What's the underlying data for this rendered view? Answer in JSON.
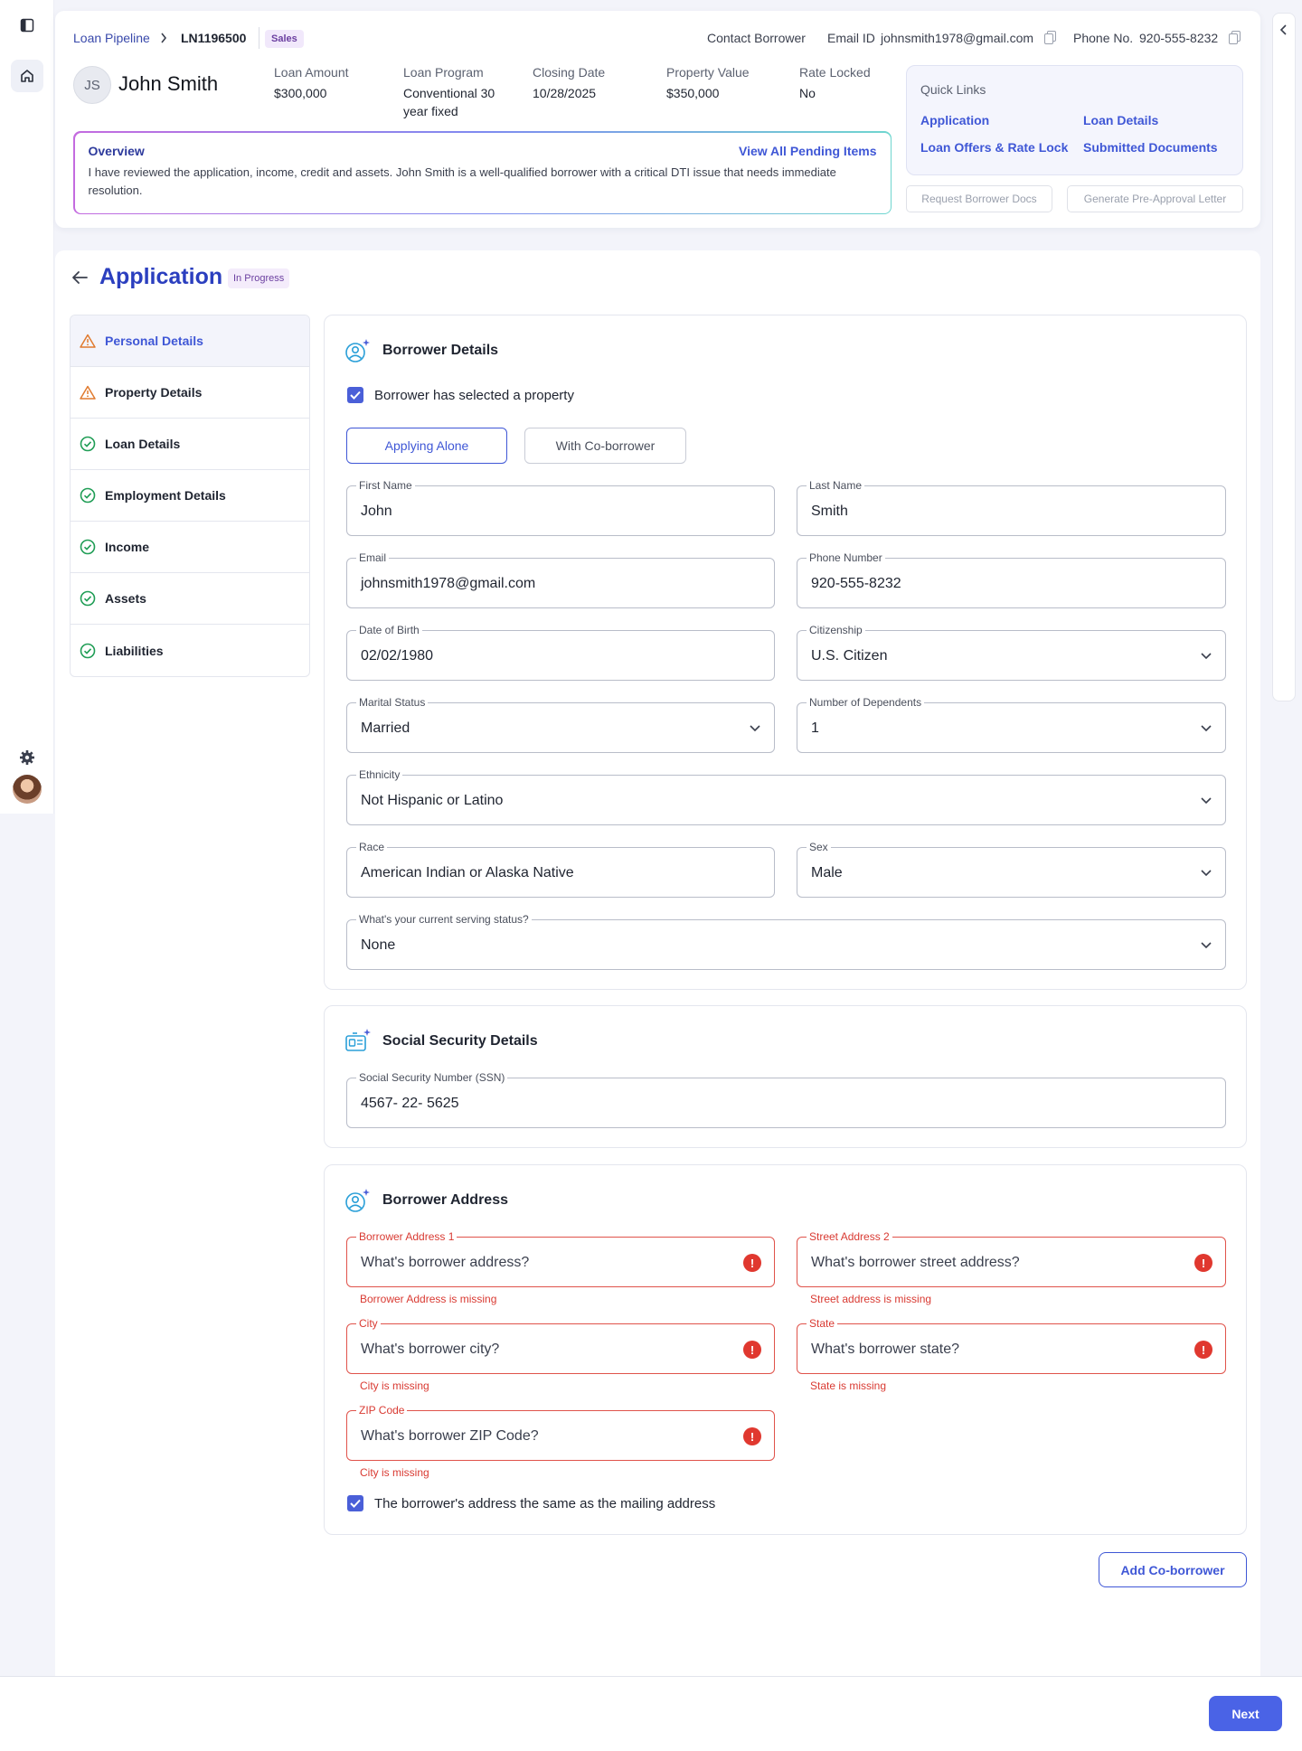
{
  "breadcrumb": {
    "pipeline": "Loan Pipeline",
    "loan_id": "LN1196500",
    "tag": "Sales"
  },
  "contact": {
    "contact_label": "Contact Borrower",
    "email_label": "Email ID",
    "email": "johnsmith1978@gmail.com",
    "phone_label": "Phone No.",
    "phone": "920-555-8232"
  },
  "borrower": {
    "initials": "JS",
    "name": "John Smith"
  },
  "loan_meta": [
    {
      "label": "Loan Amount",
      "value": "$300,000"
    },
    {
      "label": "Loan Program",
      "value": "Conventional 30 year fixed"
    },
    {
      "label": "Closing Date",
      "value": "10/28/2025"
    },
    {
      "label": "Property Value",
      "value": "$350,000"
    },
    {
      "label": "Rate Locked",
      "value": "No"
    }
  ],
  "overview": {
    "title": "Overview",
    "link": "View All Pending Items",
    "text": "I have reviewed the application, income, credit and assets. John Smith is a well-qualified borrower with a critical DTI issue that needs immediate resolution."
  },
  "quick_links": {
    "title": "Quick Links",
    "items": [
      "Application",
      "Loan Details",
      "Loan Offers & Rate Lock",
      "Submitted Documents"
    ]
  },
  "actions": {
    "request_docs": "Request Borrower Docs",
    "pre_approval": "Generate Pre-Approval Letter"
  },
  "application": {
    "title": "Application",
    "status": "In Progress"
  },
  "steps": [
    {
      "label": "Personal Details",
      "state": "warning"
    },
    {
      "label": "Property Details",
      "state": "warning"
    },
    {
      "label": "Loan Details",
      "state": "done"
    },
    {
      "label": "Employment Details",
      "state": "done"
    },
    {
      "label": "Income",
      "state": "done"
    },
    {
      "label": "Assets",
      "state": "done"
    },
    {
      "label": "Liabilities",
      "state": "done"
    }
  ],
  "borrower_details": {
    "title": "Borrower Details",
    "property_checkbox": "Borrower has selected a property",
    "applying_alone": "Applying Alone",
    "with_coborrower": "With Co-borrower",
    "fields": {
      "first_name": {
        "label": "First Name",
        "value": "John"
      },
      "last_name": {
        "label": "Last Name",
        "value": "Smith"
      },
      "email": {
        "label": "Email",
        "value": "johnsmith1978@gmail.com"
      },
      "phone": {
        "label": "Phone Number",
        "value": "920-555-8232"
      },
      "dob": {
        "label": "Date of Birth",
        "value": "02/02/1980"
      },
      "citizenship": {
        "label": "Citizenship",
        "value": "U.S. Citizen"
      },
      "marital": {
        "label": "Marital Status",
        "value": "Married"
      },
      "dependents": {
        "label": "Number of Dependents",
        "value": "1"
      },
      "ethnicity": {
        "label": "Ethnicity",
        "value": "Not Hispanic or Latino"
      },
      "race": {
        "label": "Race",
        "value": "American Indian or Alaska Native"
      },
      "sex": {
        "label": "Sex",
        "value": "Male"
      },
      "serving": {
        "label": "What's your current serving status?",
        "value": "None"
      }
    }
  },
  "ssn": {
    "title": "Social Security Details",
    "label": "Social Security Number (SSN)",
    "value": "4567- 22- 5625"
  },
  "address": {
    "title": "Borrower Address",
    "addr1": {
      "label": "Borrower Address 1",
      "placeholder": "What's borrower address?",
      "error": "Borrower Address is missing"
    },
    "addr2": {
      "label": "Street Address 2",
      "placeholder": "What's borrower street address?",
      "error": "Street address is missing"
    },
    "city": {
      "label": "City",
      "placeholder": "What's borrower city?",
      "error": "City is missing"
    },
    "state": {
      "label": "State",
      "placeholder": "What's borrower state?",
      "error": "State is missing"
    },
    "zip": {
      "label": "ZIP Code",
      "placeholder": "What's borrower ZIP Code?",
      "error": "City is missing"
    },
    "mailing_checkbox": "The borrower's address the same as the mailing address"
  },
  "buttons": {
    "add_coborrower": "Add Co-borrower",
    "next": "Next"
  },
  "colors": {
    "accent": "#3f57d6",
    "error": "#e0382f",
    "success": "#1f9d55",
    "warning": "#e07a2e"
  }
}
